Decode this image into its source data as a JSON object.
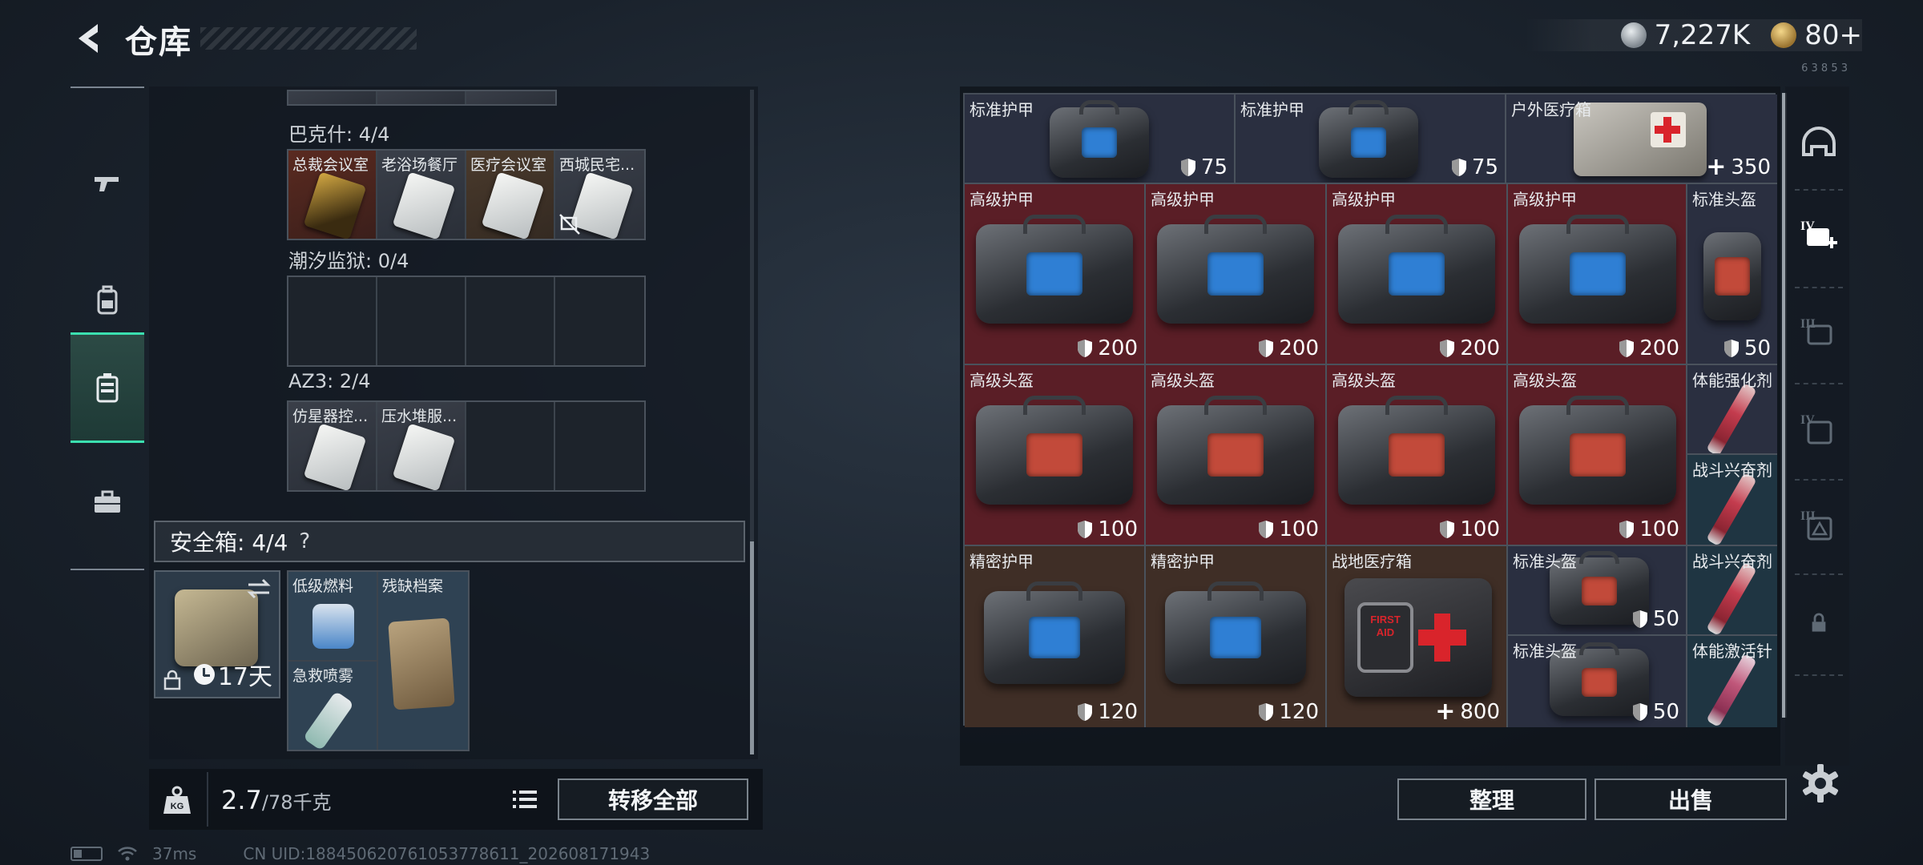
{
  "header": {
    "title": "仓库",
    "silver_amount": "7,227K",
    "gold_amount": "80+",
    "small_code": "6  3 8 5 3"
  },
  "left_nav": {
    "items": [
      "weapon-tab",
      "backpack-tab",
      "storage-tab",
      "toolbox-tab"
    ],
    "active_item": "storage-tab"
  },
  "stash": {
    "sections": [
      {
        "title": "巴克什: 4/4",
        "slots": [
          {
            "label": "总裁会议室",
            "style": "gold"
          },
          {
            "label": "老浴场餐厅",
            "style": "white"
          },
          {
            "label": "医疗会议室",
            "style": "tan"
          },
          {
            "label": "西城民宅...",
            "style": "white",
            "badge": "no-sync-icon"
          }
        ]
      },
      {
        "title": "潮汐监狱: 0/4",
        "slots": []
      },
      {
        "title": "AZ3: 2/4",
        "slots": [
          {
            "label": "仿星器控...",
            "style": "white"
          },
          {
            "label": "压水堆服...",
            "style": "white"
          }
        ]
      }
    ]
  },
  "safe_box": {
    "title": "安全箱: 4/4",
    "help": "?",
    "duration": "17天",
    "items": [
      {
        "label": "低级燃料"
      },
      {
        "label": "残缺档案"
      },
      {
        "label": "急救喷雾"
      }
    ]
  },
  "left_footer": {
    "weight_current": "2.7",
    "weight_max": "/78千克",
    "transfer_all": "转移全部"
  },
  "status_bar": {
    "ping": "37ms",
    "uid": "CN UID:188450620761053778611_202608171943"
  },
  "container": {
    "items": [
      {
        "label": "标准护甲",
        "value": "75",
        "value_icon": "shield-icon"
      },
      {
        "label": "标准护甲",
        "value": "75",
        "value_icon": "shield-icon"
      },
      {
        "label": "户外医疗箱",
        "value": "350",
        "value_icon": "heal-plus-icon"
      },
      {
        "label": "高级护甲",
        "value": "200",
        "value_icon": "shield-icon"
      },
      {
        "label": "高级护甲",
        "value": "200",
        "value_icon": "shield-icon"
      },
      {
        "label": "高级护甲",
        "value": "200",
        "value_icon": "shield-icon"
      },
      {
        "label": "高级护甲",
        "value": "200",
        "value_icon": "shield-icon"
      },
      {
        "label": "标准头盔",
        "value": "50",
        "value_icon": "shield-icon"
      },
      {
        "label": "高级头盔",
        "value": "100",
        "value_icon": "shield-icon"
      },
      {
        "label": "高级头盔",
        "value": "100",
        "value_icon": "shield-icon"
      },
      {
        "label": "高级头盔",
        "value": "100",
        "value_icon": "shield-icon"
      },
      {
        "label": "高级头盔",
        "value": "100",
        "value_icon": "shield-icon"
      },
      {
        "label": "体能强化剂",
        "value": "",
        "value_icon": ""
      },
      {
        "label": "战斗兴奋剂",
        "value": "",
        "value_icon": ""
      },
      {
        "label": "精密护甲",
        "value": "120",
        "value_icon": "shield-icon"
      },
      {
        "label": "精密护甲",
        "value": "120",
        "value_icon": "shield-icon"
      },
      {
        "label": "战地医疗箱",
        "value": "800",
        "value_icon": "heal-plus-icon"
      },
      {
        "label": "标准头盔",
        "value": "50",
        "value_icon": "shield-icon"
      },
      {
        "label": "战斗兴奋剂",
        "value": "",
        "value_icon": ""
      },
      {
        "label": "标准头盔",
        "value": "50",
        "value_icon": "shield-icon"
      },
      {
        "label": "体能激活针",
        "value": "",
        "value_icon": ""
      }
    ],
    "medkit_text": "FIRST AID",
    "sort_label": "整理",
    "sell_label": "出售"
  },
  "right_nav": {
    "labels": [
      "helmet-tab",
      "IV",
      "III",
      "IV",
      "III"
    ]
  },
  "colors": {
    "accent": "#3be0b0",
    "rarity_blue": "#2a2f40",
    "rarity_red": "#5a1e26",
    "rarity_brown": "#3f2e26",
    "rarity_slate": "#1f3542"
  }
}
